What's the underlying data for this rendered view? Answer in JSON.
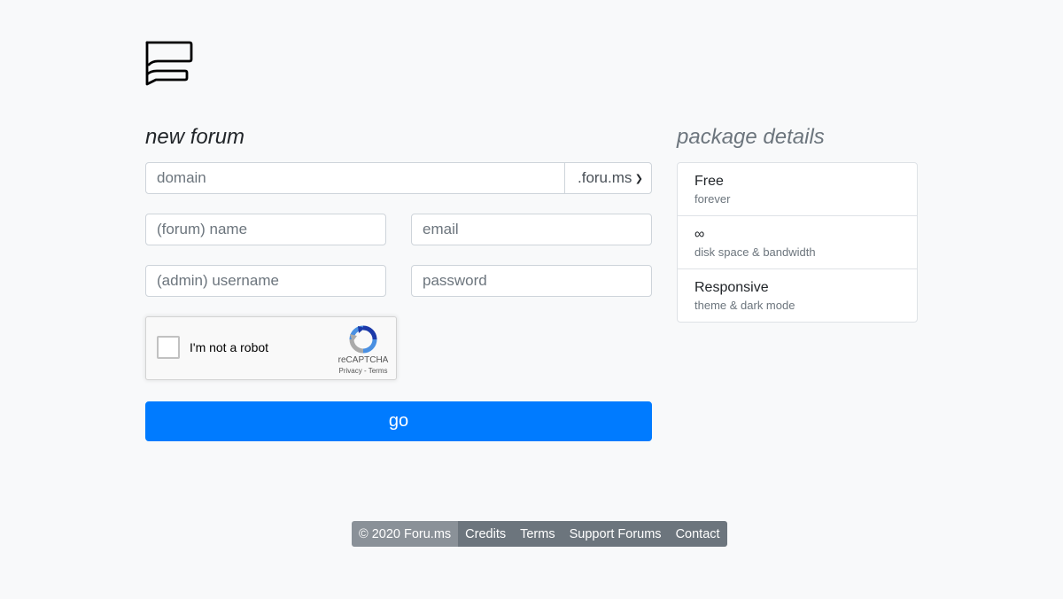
{
  "logo": {
    "icon": "forum-logo-icon"
  },
  "form": {
    "heading": "new forum",
    "domain_placeholder": "domain",
    "tld_selected": ".foru.ms",
    "name_placeholder": "(forum) name",
    "email_placeholder": "email",
    "username_placeholder": "(admin) username",
    "password_placeholder": "password",
    "submit_label": "go"
  },
  "captcha": {
    "label": "I'm not a robot",
    "brand": "reCAPTCHA",
    "privacy": "Privacy",
    "separator": " - ",
    "terms": "Terms"
  },
  "package": {
    "heading": "package details",
    "items": [
      {
        "title": "Free",
        "subtitle": "forever"
      },
      {
        "title": "∞",
        "subtitle": "disk space & bandwidth"
      },
      {
        "title": "Responsive",
        "subtitle": "theme & dark mode"
      }
    ]
  },
  "footer": {
    "copyright": "© 2020 Foru.ms",
    "links": [
      "Credits",
      "Terms",
      "Support Forums",
      "Contact"
    ]
  },
  "colors": {
    "background": "#f8f9fa",
    "primary": "#007bff",
    "muted": "#6c757d",
    "footer_copyright_bg": "#8a9198"
  }
}
